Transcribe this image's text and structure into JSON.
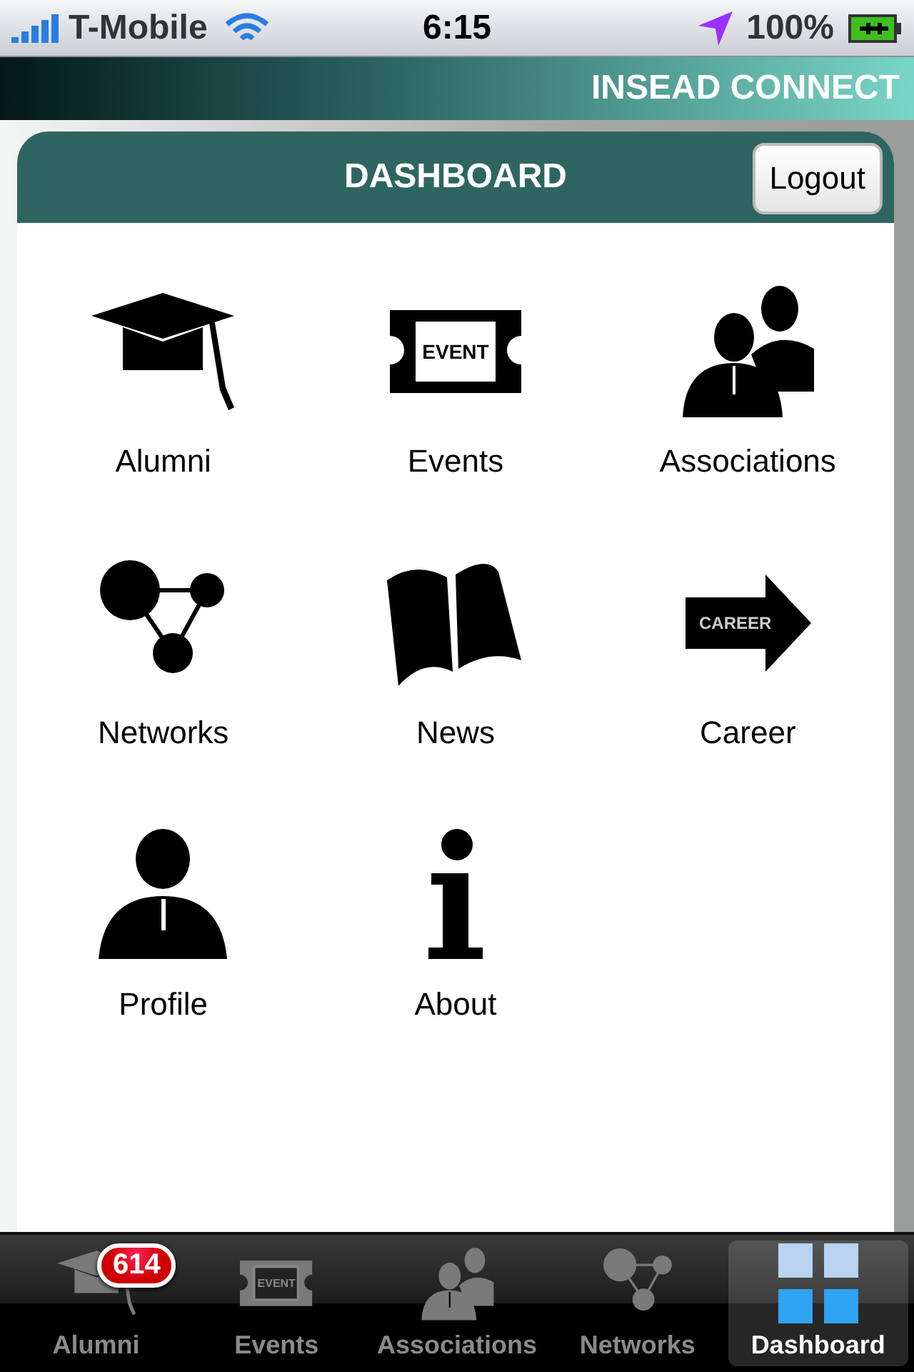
{
  "status_bar": {
    "carrier": "T-Mobile",
    "time": "6:15",
    "battery": "100%"
  },
  "app_title": "INSEAD CONNECT",
  "panel": {
    "title": "DASHBOARD",
    "logout": "Logout"
  },
  "items": [
    {
      "label": "Alumni",
      "kind": "cap"
    },
    {
      "label": "Events",
      "kind": "ticket",
      "icon_text": "EVENT"
    },
    {
      "label": "Associations",
      "kind": "people"
    },
    {
      "label": "Networks",
      "kind": "network"
    },
    {
      "label": "News",
      "kind": "book"
    },
    {
      "label": "Career",
      "kind": "arrow",
      "icon_text": "CAREER"
    },
    {
      "label": "Profile",
      "kind": "person"
    },
    {
      "label": "About",
      "kind": "info"
    }
  ],
  "tabs": [
    {
      "label": "Alumni",
      "kind": "cap",
      "selected": false,
      "badge": "614"
    },
    {
      "label": "Events",
      "kind": "ticket",
      "selected": false,
      "icon_text": "EVENT"
    },
    {
      "label": "Associations",
      "kind": "people",
      "selected": false
    },
    {
      "label": "Networks",
      "kind": "network",
      "selected": false
    },
    {
      "label": "Dashboard",
      "kind": "grid",
      "selected": true
    }
  ]
}
